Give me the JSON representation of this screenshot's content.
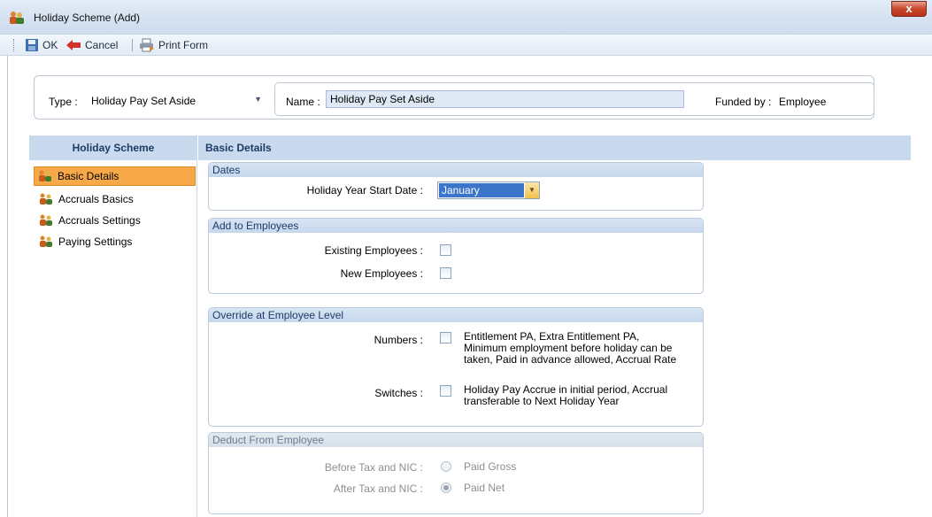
{
  "window": {
    "title": "Holiday Scheme (Add)",
    "close_glyph": "x"
  },
  "toolbar": {
    "ok": "OK",
    "cancel": "Cancel",
    "print": "Print Form"
  },
  "header": {
    "type_label": "Type :",
    "type_value": "Holiday Pay Set Aside",
    "name_label": "Name :",
    "name_value": "Holiday Pay Set Aside",
    "funded_label": "Funded by :",
    "funded_value": "Employee"
  },
  "sidebar": {
    "title": "Holiday Scheme",
    "items": [
      {
        "label": "Basic Details",
        "selected": true
      },
      {
        "label": "Accruals Basics",
        "selected": false
      },
      {
        "label": "Accruals Settings",
        "selected": false
      },
      {
        "label": "Paying Settings",
        "selected": false
      }
    ]
  },
  "main": {
    "title": "Basic Details",
    "dates": {
      "title": "Dates",
      "start_label": "Holiday Year Start Date :",
      "start_value": "January"
    },
    "add": {
      "title": "Add to Employees",
      "existing_label": "Existing Employees :",
      "new_label": "New Employees :"
    },
    "override": {
      "title": "Override at Employee Level",
      "numbers_label": "Numbers :",
      "numbers_desc1": "Entitlement PA, Extra Entitlement PA,",
      "numbers_desc2": "Minimum employment before holiday can be",
      "numbers_desc3": "taken, Paid in advance allowed, Accrual Rate",
      "switches_label": "Switches :",
      "switches_desc1": "Holiday Pay Accrue in initial period, Accrual",
      "switches_desc2": "transferable to Next Holiday Year"
    },
    "deduct": {
      "title": "Deduct From Employee",
      "before_label": "Before Tax and NIC :",
      "before_value": "Paid Gross",
      "after_label": "After Tax and NIC :",
      "after_value": "Paid Net"
    }
  },
  "colors": {
    "selected_nav": "#f7a94a",
    "header_band": "#c9daee",
    "select_highlight": "#3a75c9"
  }
}
